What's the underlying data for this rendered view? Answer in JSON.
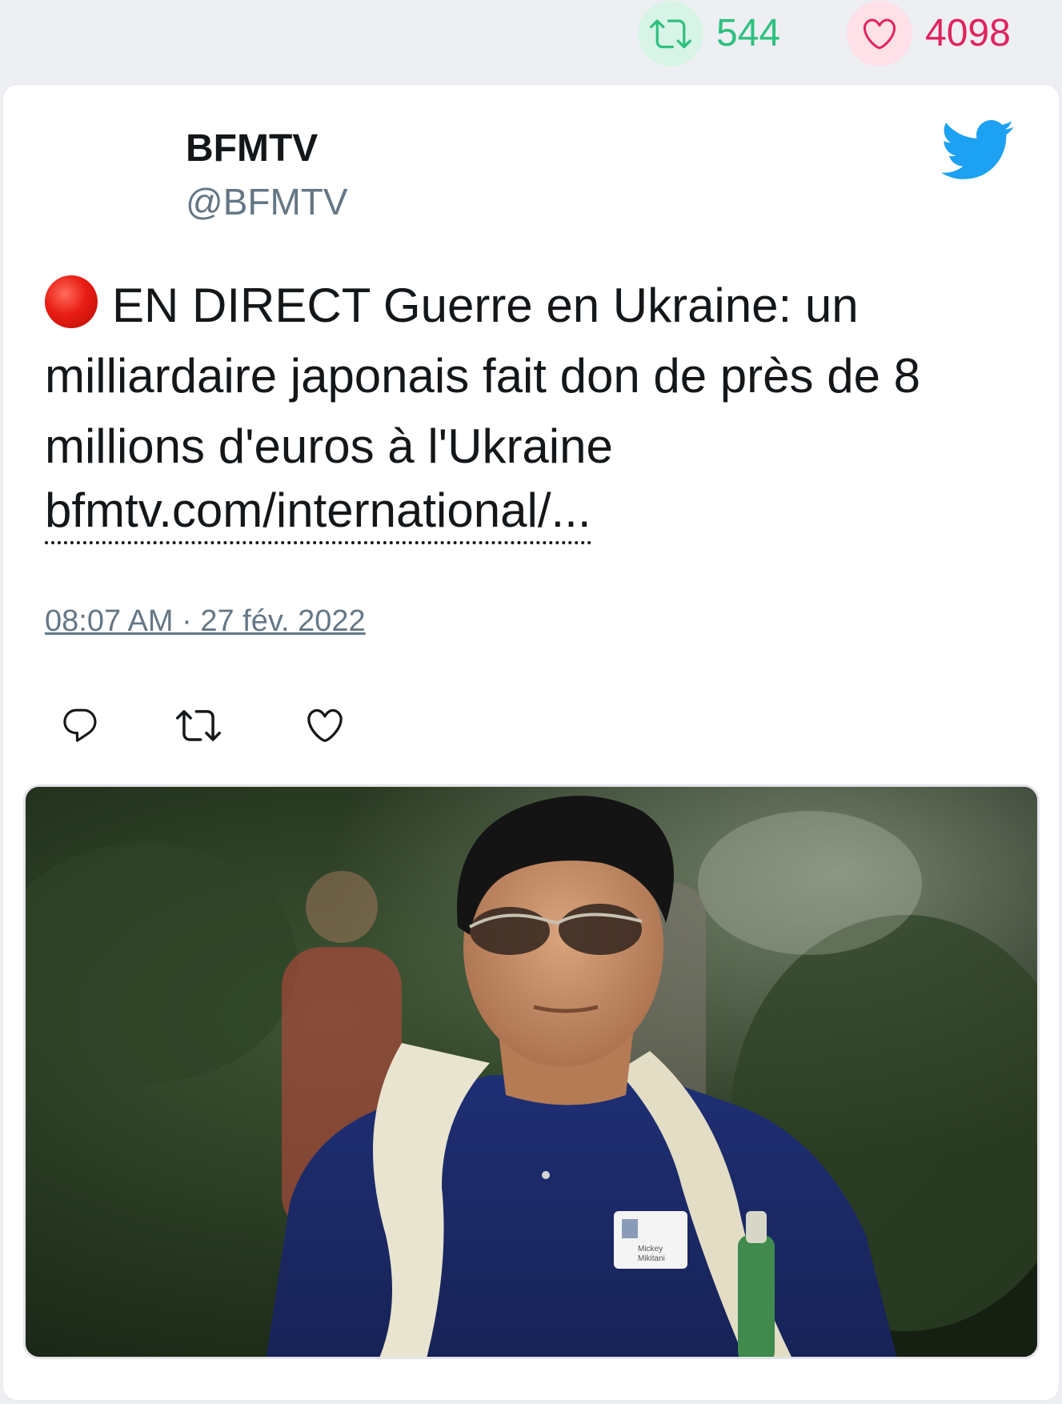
{
  "stats": {
    "retweets": "544",
    "likes": "4098"
  },
  "tweet": {
    "author_name": "BFMTV",
    "author_handle": "@BFMTV",
    "text": "EN DIRECT Guerre en Ukraine: un milliardaire japonais fait don de près de 8 millions d'euros à l'Ukraine",
    "link": "bfmtv.com/international/...",
    "timestamp": "08:07 AM · 27 fév. 2022"
  },
  "photo": {
    "badge_name": "Mickey",
    "badge_surname": "Mikitani"
  },
  "colors": {
    "retweet": "#2fc07f",
    "like": "#e0245e",
    "twitter_blue": "#1da1f2"
  },
  "icons": {
    "retweet": "retweet-icon",
    "like": "heart-icon",
    "reply": "reply-icon",
    "brand": "twitter-bird-icon",
    "live": "red-circle-icon"
  }
}
